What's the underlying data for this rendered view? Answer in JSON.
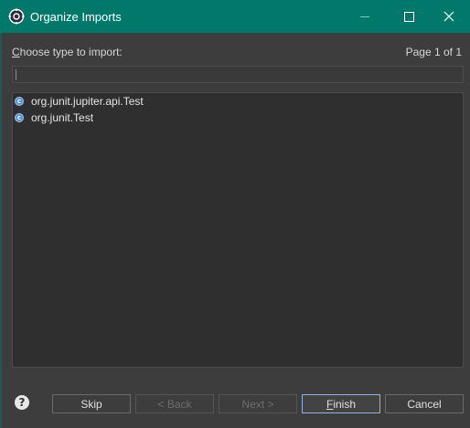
{
  "window": {
    "title": "Organize Imports"
  },
  "dialog": {
    "prompt_underlined": "C",
    "prompt_rest": "hoose type to import:",
    "page_info": "Page 1 of 1",
    "filter": {
      "value": "",
      "placeholder": ""
    },
    "types": [
      {
        "label": "org.junit.jupiter.api.Test",
        "icon": "class-icon"
      },
      {
        "label": "org.junit.Test",
        "icon": "class-icon"
      }
    ]
  },
  "buttons": {
    "help": "?",
    "skip": "Skip",
    "back": "< Back",
    "next": "Next >",
    "finish_underlined": "F",
    "finish_rest": "inish",
    "cancel": "Cancel"
  },
  "colors": {
    "title_bar": "#00796b",
    "background": "#3d3d3d",
    "list_background": "#2f2f2f",
    "class_icon": "#5a8fd6"
  }
}
